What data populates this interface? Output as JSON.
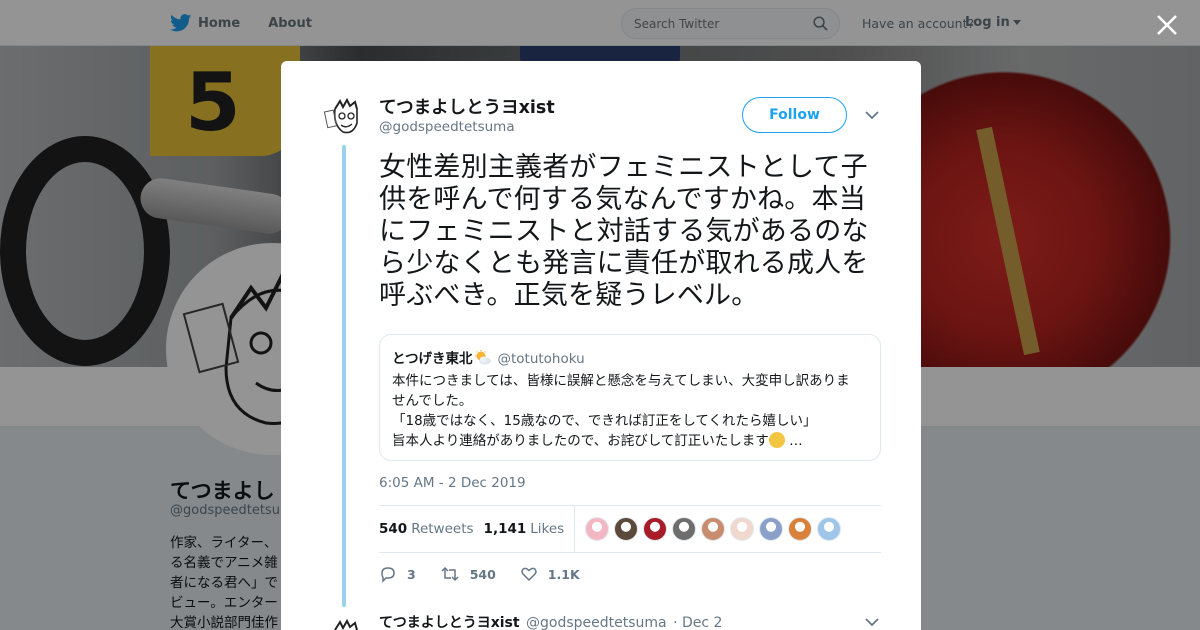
{
  "nav": {
    "home_label": "Home",
    "about_label": "About",
    "search_placeholder": "Search Twitter",
    "have_account": "Have an account?",
    "login_label": "Log in"
  },
  "banner": {
    "number": "5"
  },
  "profile": {
    "name": "てつまよし",
    "handle": "@godspeedtetsum",
    "bio_lines": [
      "作家、ライター、",
      "る名義でアニメ雑",
      "者になる君へ」で",
      "ビュー。エンター",
      "大賞小説部門佳作"
    ]
  },
  "tweet": {
    "author_name": "てつまよしとうヨxist",
    "author_handle": "@godspeedtetsuma",
    "follow_label": "Follow",
    "text": "女性差別主義者がフェミニストとして子供を呼んで何する気なんですかね。本当にフェミニストと対話する気があるのなら少なくとも発言に責任が取れる成人を呼ぶべき。正気を疑うレベル。",
    "quote": {
      "name": "とつげき東北",
      "handle": "@totutohoku",
      "lines": [
        "本件につきましては、皆様に誤解と懸念を与えてしまい、大変申し訳ありま",
        "せんでした。",
        "「18歳ではなく、15歳なので、できれば訂正をしてくれたら嬉しい」",
        "旨本人より連絡がありましたので、お詫びして訂正いたします"
      ],
      "ellipsis": "…"
    },
    "timestamp": "6:05 AM - 2 Dec 2019",
    "retweets_count": "540",
    "retweets_label": "Retweets",
    "likes_count": "1,141",
    "likes_label": "Likes",
    "liker_colors": [
      "#f3b7c4",
      "#5b4a3a",
      "#a81c2a",
      "#6d6d6d",
      "#c98c6f",
      "#f1d8cf",
      "#8aa0c8",
      "#d9803a",
      "#9ec6e8"
    ],
    "reply_count": "3",
    "retweet_action_count": "540",
    "like_action_count": "1.1K"
  },
  "reply": {
    "name": "てつまよしとうヨxist",
    "handle": "@godspeedtetsuma",
    "date": "· Dec 2"
  },
  "colors": {
    "accent": "#1da1f2",
    "thread_line": "#9ad0f0"
  }
}
